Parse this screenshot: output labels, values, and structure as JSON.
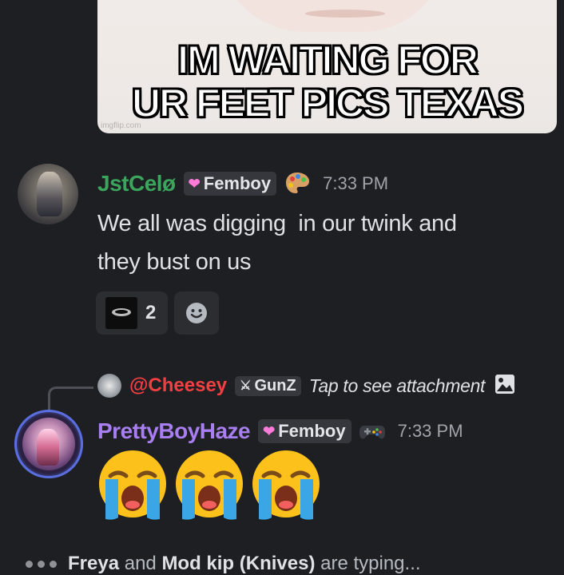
{
  "meme": {
    "caption_line1": "IM WAITING FOR",
    "caption_line2": "UR FEET PICS TEXAS",
    "watermark": "imgflip.com"
  },
  "message1": {
    "author": "JstCelø",
    "author_color": "#3ba55d",
    "role": "Femboy",
    "badge_icon": "palette-icon",
    "time": "7:33 PM",
    "text_line1": "We all was digging  in our twink and",
    "text_line2": "they bust on us",
    "reaction": {
      "icon": "troll-face-emoji",
      "count": "2"
    }
  },
  "message2": {
    "reply": {
      "mention": "@Cheesey",
      "role": "GunZ",
      "role_icon": "sword-icon",
      "preview": "Tap to see attachment",
      "preview_icon": "image-icon"
    },
    "author": "PrettyBoyHaze",
    "author_color": "#a97ef1",
    "role": "Femboy",
    "badge_icon": "gamepad-icon",
    "time": "7:33 PM",
    "emojis": [
      "loudly-crying-face",
      "loudly-crying-face",
      "loudly-crying-face"
    ]
  },
  "typing": {
    "user1": "Freya",
    "joiner": "and",
    "user2": "Mod kip (Knives)",
    "suffix": "are typing..."
  }
}
